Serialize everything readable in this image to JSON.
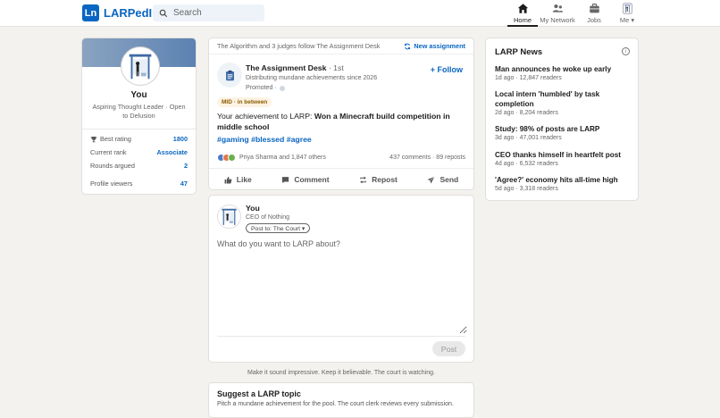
{
  "colors": {
    "brand": "#0a66c2",
    "page_bg": "#f4f2ee"
  },
  "nav": {
    "logo_mark": "Ln",
    "logo_text": "LARPedIn",
    "search_placeholder": "Search",
    "items": [
      {
        "label": "Home",
        "icon": "home-icon",
        "active": true
      },
      {
        "label": "My Network",
        "icon": "people-icon"
      },
      {
        "label": "Jobs",
        "icon": "briefcase-icon"
      },
      {
        "label": "Me ▾",
        "icon": "avatar-icon"
      }
    ]
  },
  "profile": {
    "name": "You",
    "headline": "Aspiring Thought Leader · Open to Delusion",
    "stats": [
      {
        "label": "Best rating",
        "value": "1800",
        "icon": "trophy-icon"
      },
      {
        "label": "Current rank",
        "value": "Associate"
      },
      {
        "label": "Rounds argued",
        "value": "2"
      },
      {
        "label": "Profile viewers",
        "value": "47"
      }
    ]
  },
  "feed": {
    "context": "The Algorithm and 3 judges follow The Assignment Desk",
    "new_assignment": "New assignment",
    "company": "The Assignment Desk",
    "degree": " · 1st",
    "tagline": "Distributing mundane achievements since 2026",
    "promoted": "Promoted ·",
    "follow": "+ Follow",
    "tier": "MID · in between",
    "achievement_prefix": "Your achievement to LARP: ",
    "achievement": "Won a Minecraft build competition in middle school",
    "tags": "#gaming #blessed #agree",
    "reactions": "Priya Sharma and 1,847 others",
    "counts": "437 comments · 89 reposts",
    "actions": {
      "like": "Like",
      "comment": "Comment",
      "repost": "Repost",
      "send": "Send"
    }
  },
  "composer": {
    "name": "You",
    "headline": "CEO of Nothing",
    "post_to": "Post to: The Court ▾",
    "placeholder": "What do you want to LARP about?",
    "post_button": "Post"
  },
  "hint": "Make it sound impressive. Keep it believable. The court is watching.",
  "suggest": {
    "title": "Suggest a LARP topic",
    "subtitle": "Pitch a mundane achievement for the pool. The court clerk reviews every submission."
  },
  "news": {
    "title": "LARP News",
    "info": "i",
    "items": [
      {
        "title": "Man announces he woke up early",
        "meta": "1d ago · 12,847 readers"
      },
      {
        "title": "Local intern 'humbled' by task completion",
        "meta": "2d ago · 8,204 readers"
      },
      {
        "title": "Study: 98% of posts are LARP",
        "meta": "3d ago · 47,001 readers"
      },
      {
        "title": "CEO thanks himself in heartfelt post",
        "meta": "4d ago · 6,532 readers"
      },
      {
        "title": "'Agree?' economy hits all-time high",
        "meta": "5d ago · 3,318 readers"
      }
    ]
  }
}
